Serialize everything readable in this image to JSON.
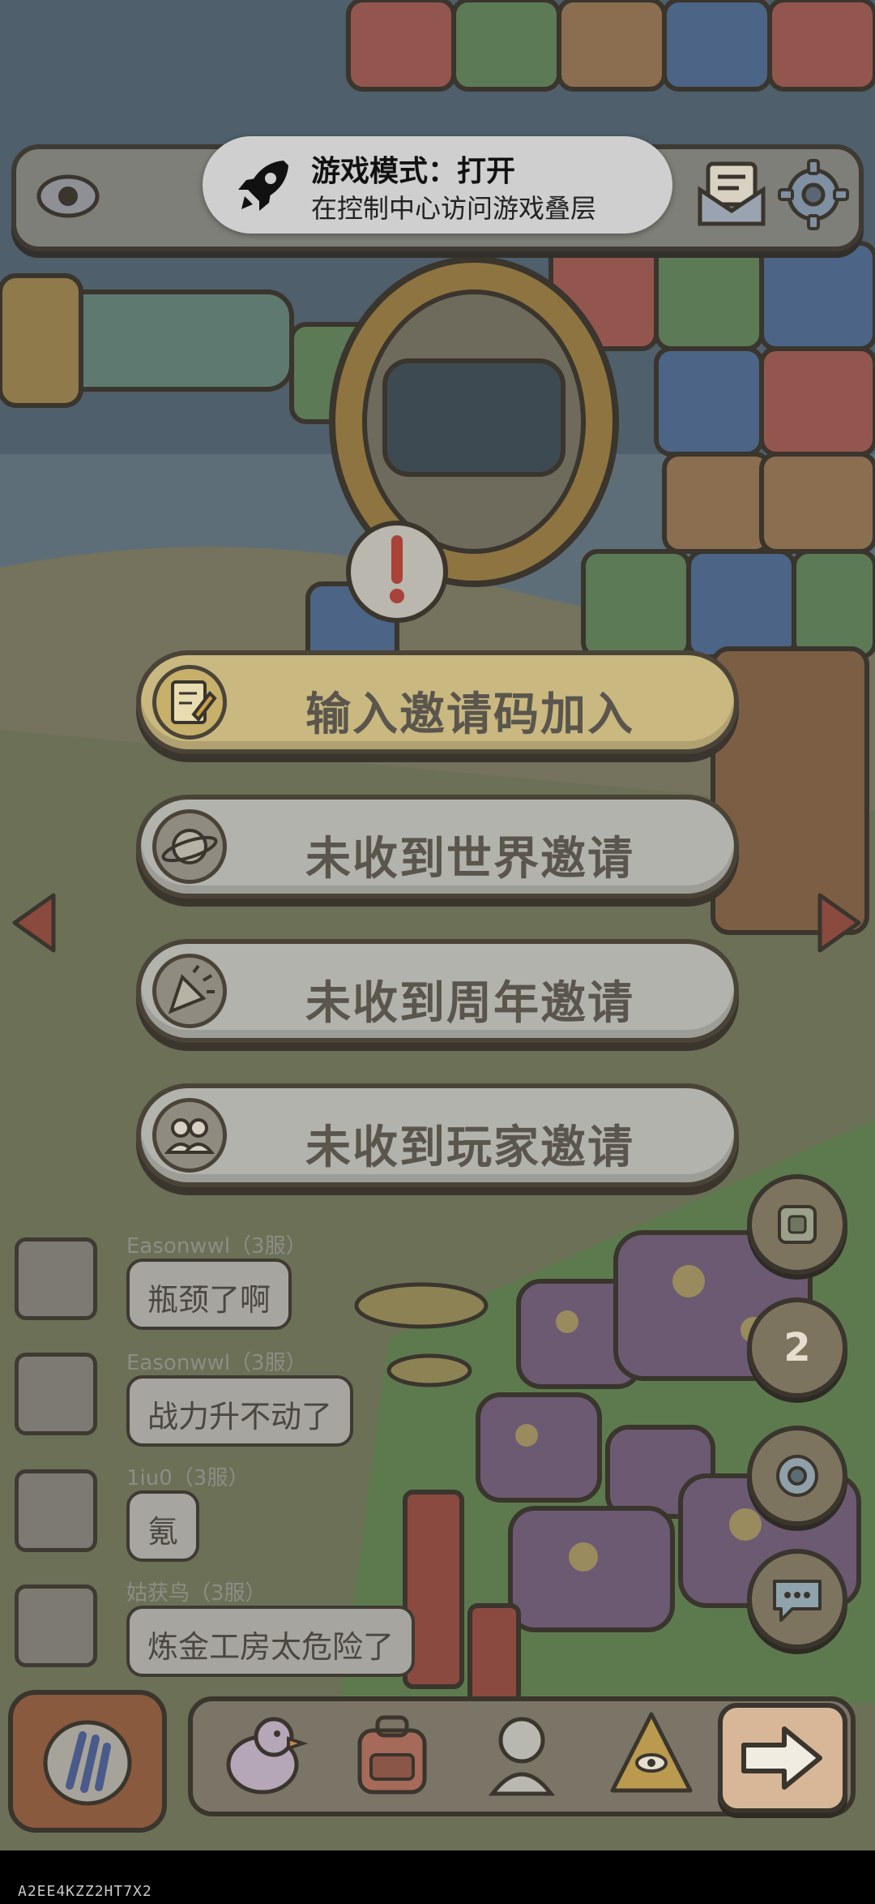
{
  "toast": {
    "title": "游戏模式：打开",
    "subtitle": "在控制中心访问游戏叠层"
  },
  "topbar": {
    "left_icon": "eye-icon",
    "right_icons": [
      "mail-icon",
      "gear-icon"
    ]
  },
  "menu": {
    "items": [
      {
        "label": "输入邀请码加入",
        "icon": "pencil-note-icon"
      },
      {
        "label": "未收到世界邀请",
        "icon": "planet-icon"
      },
      {
        "label": "未收到周年邀请",
        "icon": "party-popper-icon"
      },
      {
        "label": "未收到玩家邀请",
        "icon": "two-people-icon"
      }
    ]
  },
  "chat": {
    "messages": [
      {
        "name": "Easonwwl",
        "server": "（3服）",
        "text": "瓶颈了啊"
      },
      {
        "name": "Easonwwl",
        "server": "（3服）",
        "text": "战力升不动了"
      },
      {
        "name": "1iu0",
        "server": "（3服）",
        "text": "氪"
      },
      {
        "name": "姑获鸟",
        "server": "（3服）",
        "text": "炼金工房太危险了"
      }
    ]
  },
  "side_buttons": {
    "badge_number": "2"
  },
  "watermark": "A2EE4KZZ2HT7X2",
  "colors": {
    "gold_button": "#c9b880",
    "gray_button": "#b3b3ad",
    "outline": "#3f3a33"
  }
}
